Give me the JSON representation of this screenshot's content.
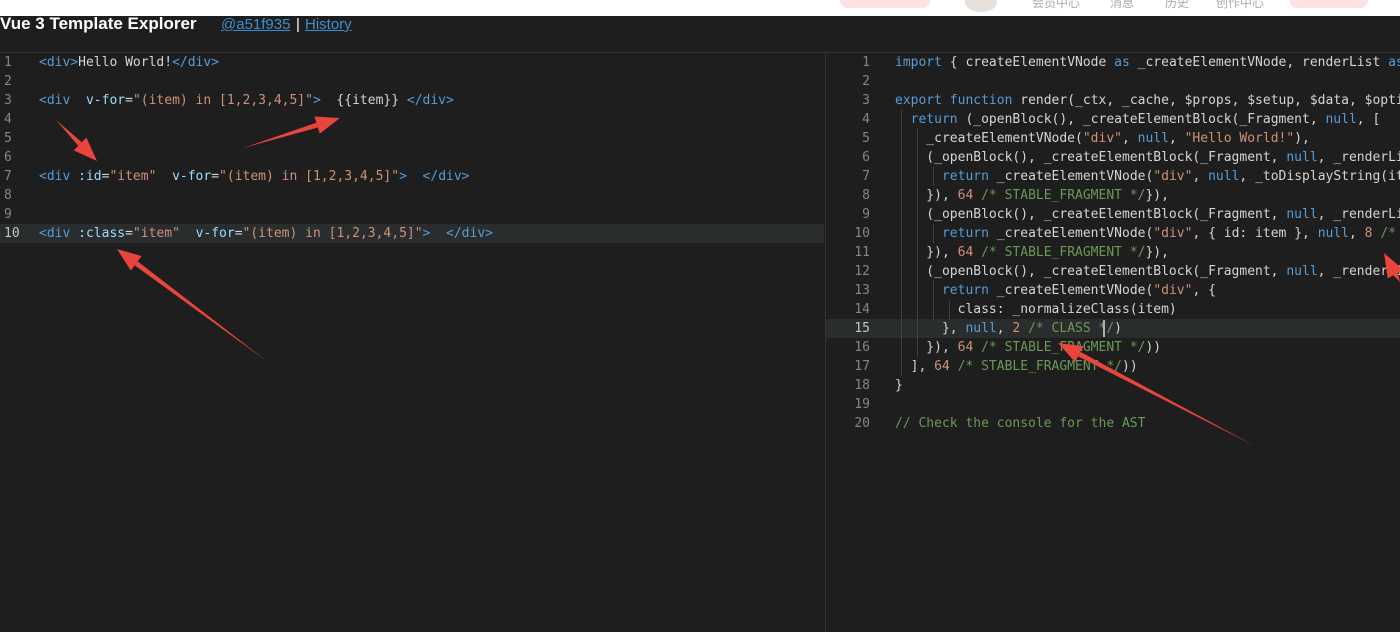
{
  "header": {
    "title": "Vue 3 Template Explorer",
    "commit": "@a51f935",
    "separator": "|",
    "history": "History"
  },
  "topbar": {
    "nav_items": [
      "会员中心",
      "消息",
      "历史",
      "创作中心"
    ]
  },
  "editor": {
    "left_lines": [
      {
        "n": "1",
        "tokens": [
          [
            "tag",
            "<div>"
          ],
          [
            "txt",
            "Hello World!"
          ],
          [
            "tag",
            "</div>"
          ]
        ]
      },
      {
        "n": "2",
        "tokens": []
      },
      {
        "n": "3",
        "tokens": [
          [
            "tag",
            "<div"
          ],
          [
            "txt",
            "  "
          ],
          [
            "attr",
            "v-for"
          ],
          [
            "txt",
            "="
          ],
          [
            "str",
            "\"(item) in [1,2,3,4,5]\""
          ],
          [
            "tag",
            ">"
          ],
          [
            "txt",
            "  {{item}} "
          ],
          [
            "tag",
            "</div>"
          ]
        ]
      },
      {
        "n": "4",
        "tokens": []
      },
      {
        "n": "5",
        "tokens": []
      },
      {
        "n": "6",
        "tokens": []
      },
      {
        "n": "7",
        "tokens": [
          [
            "tag",
            "<div"
          ],
          [
            "txt",
            " "
          ],
          [
            "attr",
            ":id"
          ],
          [
            "txt",
            "="
          ],
          [
            "str",
            "\"item\""
          ],
          [
            "txt",
            "  "
          ],
          [
            "attr",
            "v-for"
          ],
          [
            "txt",
            "="
          ],
          [
            "str",
            "\"(item) in [1,2,3,4,5]\""
          ],
          [
            "tag",
            ">"
          ],
          [
            "txt",
            "  "
          ],
          [
            "tag",
            "</div>"
          ]
        ]
      },
      {
        "n": "8",
        "tokens": []
      },
      {
        "n": "9",
        "tokens": []
      },
      {
        "n": "10",
        "tokens": [
          [
            "tag",
            "<div"
          ],
          [
            "txt",
            " "
          ],
          [
            "attr",
            ":class"
          ],
          [
            "txt",
            "="
          ],
          [
            "str",
            "\"item\""
          ],
          [
            "txt",
            "  "
          ],
          [
            "attr",
            "v-for"
          ],
          [
            "txt",
            "="
          ],
          [
            "str",
            "\"(item) in [1,2,3,4,5]\""
          ],
          [
            "tag",
            ">"
          ],
          [
            "txt",
            "  "
          ],
          [
            "tag",
            "</div>"
          ]
        ]
      }
    ],
    "right_lines": [
      {
        "n": "1",
        "tokens": [
          [
            "kw",
            "import"
          ],
          [
            "txt",
            " { createElementVNode "
          ],
          [
            "kw",
            "as"
          ],
          [
            "txt",
            " _createElementVNode, renderList "
          ],
          [
            "kw",
            "as"
          ]
        ]
      },
      {
        "n": "2",
        "tokens": []
      },
      {
        "n": "3",
        "tokens": [
          [
            "kw",
            "export"
          ],
          [
            "txt",
            " "
          ],
          [
            "kw",
            "function"
          ],
          [
            "txt",
            " render(_ctx, _cache, $props, $setup, $data, $opti"
          ]
        ]
      },
      {
        "n": "4",
        "tokens": [
          [
            "txt",
            "  "
          ],
          [
            "kw",
            "return"
          ],
          [
            "txt",
            " (_openBlock(), _createElementBlock(_Fragment, "
          ],
          [
            "kw",
            "null"
          ],
          [
            "txt",
            ", ["
          ]
        ]
      },
      {
        "n": "5",
        "tokens": [
          [
            "txt",
            "    _createElementVNode("
          ],
          [
            "str",
            "\"div\""
          ],
          [
            "txt",
            ", "
          ],
          [
            "kw",
            "null"
          ],
          [
            "txt",
            ", "
          ],
          [
            "str",
            "\"Hello World!\""
          ],
          [
            "txt",
            "),"
          ]
        ]
      },
      {
        "n": "6",
        "tokens": [
          [
            "txt",
            "    (_openBlock(), _createElementBlock(_Fragment, "
          ],
          [
            "kw",
            "null"
          ],
          [
            "txt",
            ", _renderLi"
          ]
        ]
      },
      {
        "n": "7",
        "tokens": [
          [
            "txt",
            "      "
          ],
          [
            "kw",
            "return"
          ],
          [
            "txt",
            " _createElementVNode("
          ],
          [
            "str",
            "\"div\""
          ],
          [
            "txt",
            ", "
          ],
          [
            "kw",
            "null"
          ],
          [
            "txt",
            ", _toDisplayString(it"
          ]
        ]
      },
      {
        "n": "8",
        "tokens": [
          [
            "txt",
            "    }), "
          ],
          [
            "num",
            "64"
          ],
          [
            "txt",
            " "
          ],
          [
            "com",
            "/* STABLE_FRAGMENT */"
          ],
          [
            "txt",
            "}),"
          ]
        ]
      },
      {
        "n": "9",
        "tokens": [
          [
            "txt",
            "    (_openBlock(), _createElementBlock(_Fragment, "
          ],
          [
            "kw",
            "null"
          ],
          [
            "txt",
            ", _renderLi"
          ]
        ]
      },
      {
        "n": "10",
        "tokens": [
          [
            "txt",
            "      "
          ],
          [
            "kw",
            "return"
          ],
          [
            "txt",
            " _createElementVNode("
          ],
          [
            "str",
            "\"div\""
          ],
          [
            "txt",
            ", { id: item }, "
          ],
          [
            "kw",
            "null"
          ],
          [
            "txt",
            ", "
          ],
          [
            "num",
            "8"
          ],
          [
            "txt",
            " "
          ],
          [
            "com",
            "/*"
          ]
        ]
      },
      {
        "n": "11",
        "tokens": [
          [
            "txt",
            "    }), "
          ],
          [
            "num",
            "64"
          ],
          [
            "txt",
            " "
          ],
          [
            "com",
            "/* STABLE_FRAGMENT */"
          ],
          [
            "txt",
            "}),"
          ]
        ]
      },
      {
        "n": "12",
        "tokens": [
          [
            "txt",
            "    (_openBlock(), _createElementBlock(_Fragment, "
          ],
          [
            "kw",
            "null"
          ],
          [
            "txt",
            ", _renderLi"
          ]
        ]
      },
      {
        "n": "13",
        "tokens": [
          [
            "txt",
            "      "
          ],
          [
            "kw",
            "return"
          ],
          [
            "txt",
            " _createElementVNode("
          ],
          [
            "str",
            "\"div\""
          ],
          [
            "txt",
            ", {"
          ]
        ]
      },
      {
        "n": "14",
        "tokens": [
          [
            "txt",
            "        class: _normalizeClass(item)"
          ]
        ]
      },
      {
        "n": "15",
        "tokens": [
          [
            "txt",
            "      }, "
          ],
          [
            "kw",
            "null"
          ],
          [
            "txt",
            ", "
          ],
          [
            "num",
            "2"
          ],
          [
            "txt",
            " "
          ],
          [
            "com",
            "/* CLASS */"
          ],
          [
            "txt",
            ")"
          ]
        ]
      },
      {
        "n": "16",
        "tokens": [
          [
            "txt",
            "    }), "
          ],
          [
            "num",
            "64"
          ],
          [
            "txt",
            " "
          ],
          [
            "com",
            "/* STABLE_FRAGMENT */"
          ],
          [
            "txt",
            "))"
          ]
        ]
      },
      {
        "n": "17",
        "tokens": [
          [
            "txt",
            "  ], "
          ],
          [
            "num",
            "64"
          ],
          [
            "txt",
            " "
          ],
          [
            "com",
            "/* STABLE_FRAGMENT */"
          ],
          [
            "txt",
            "))"
          ]
        ]
      },
      {
        "n": "18",
        "tokens": [
          [
            "txt",
            "}"
          ]
        ]
      },
      {
        "n": "19",
        "tokens": []
      },
      {
        "n": "20",
        "tokens": [
          [
            "com",
            "// Check the console for the AST"
          ]
        ]
      }
    ]
  },
  "annotation_color": "#e8453c"
}
